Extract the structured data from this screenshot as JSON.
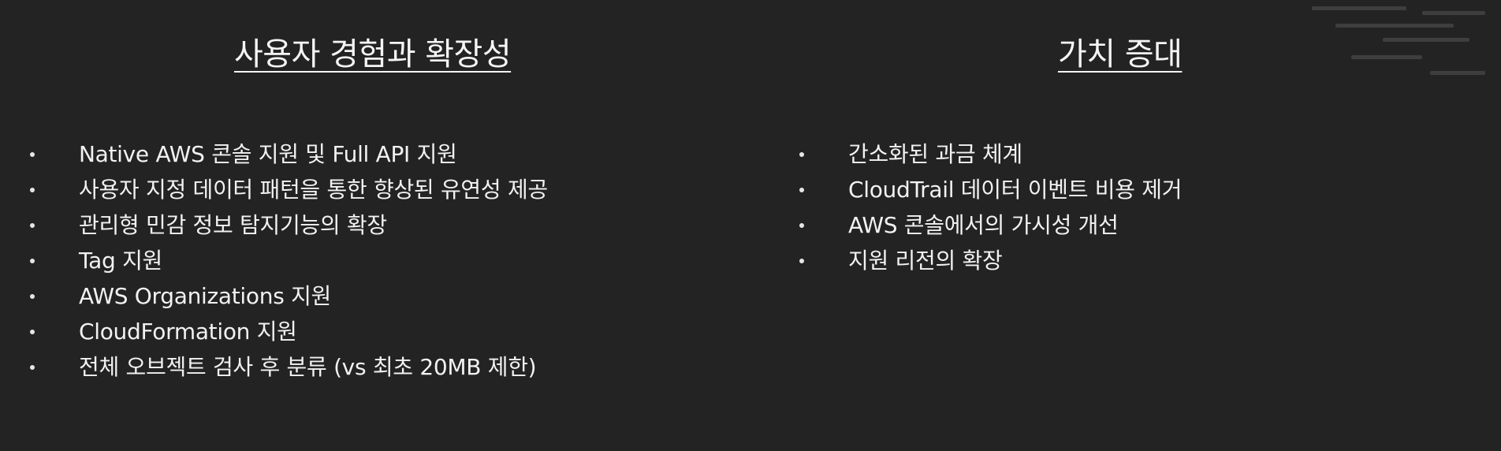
{
  "left_column": {
    "title": "사용자 경험과 확장성",
    "items": [
      "Native AWS 콘솔 지원 및 Full API 지원",
      "사용자 지정 데이터 패턴을 통한 향상된 유연성 제공",
      "관리형 민감 정보 탐지기능의 확장",
      "Tag 지원",
      "AWS Organizations 지원",
      "CloudFormation 지원",
      "전체 오브젝트 검사 후 분류 (vs 최초 20MB 제한)"
    ]
  },
  "right_column": {
    "title": "가치 증대",
    "items": [
      "간소화된 과금 체계",
      "CloudTrail 데이터 이벤트 비용 제거",
      "AWS 콘솔에서의 가시성 개선",
      "지원 리전의 확장"
    ]
  },
  "colors": {
    "background": "#232323",
    "text": "#f2f2f2"
  }
}
